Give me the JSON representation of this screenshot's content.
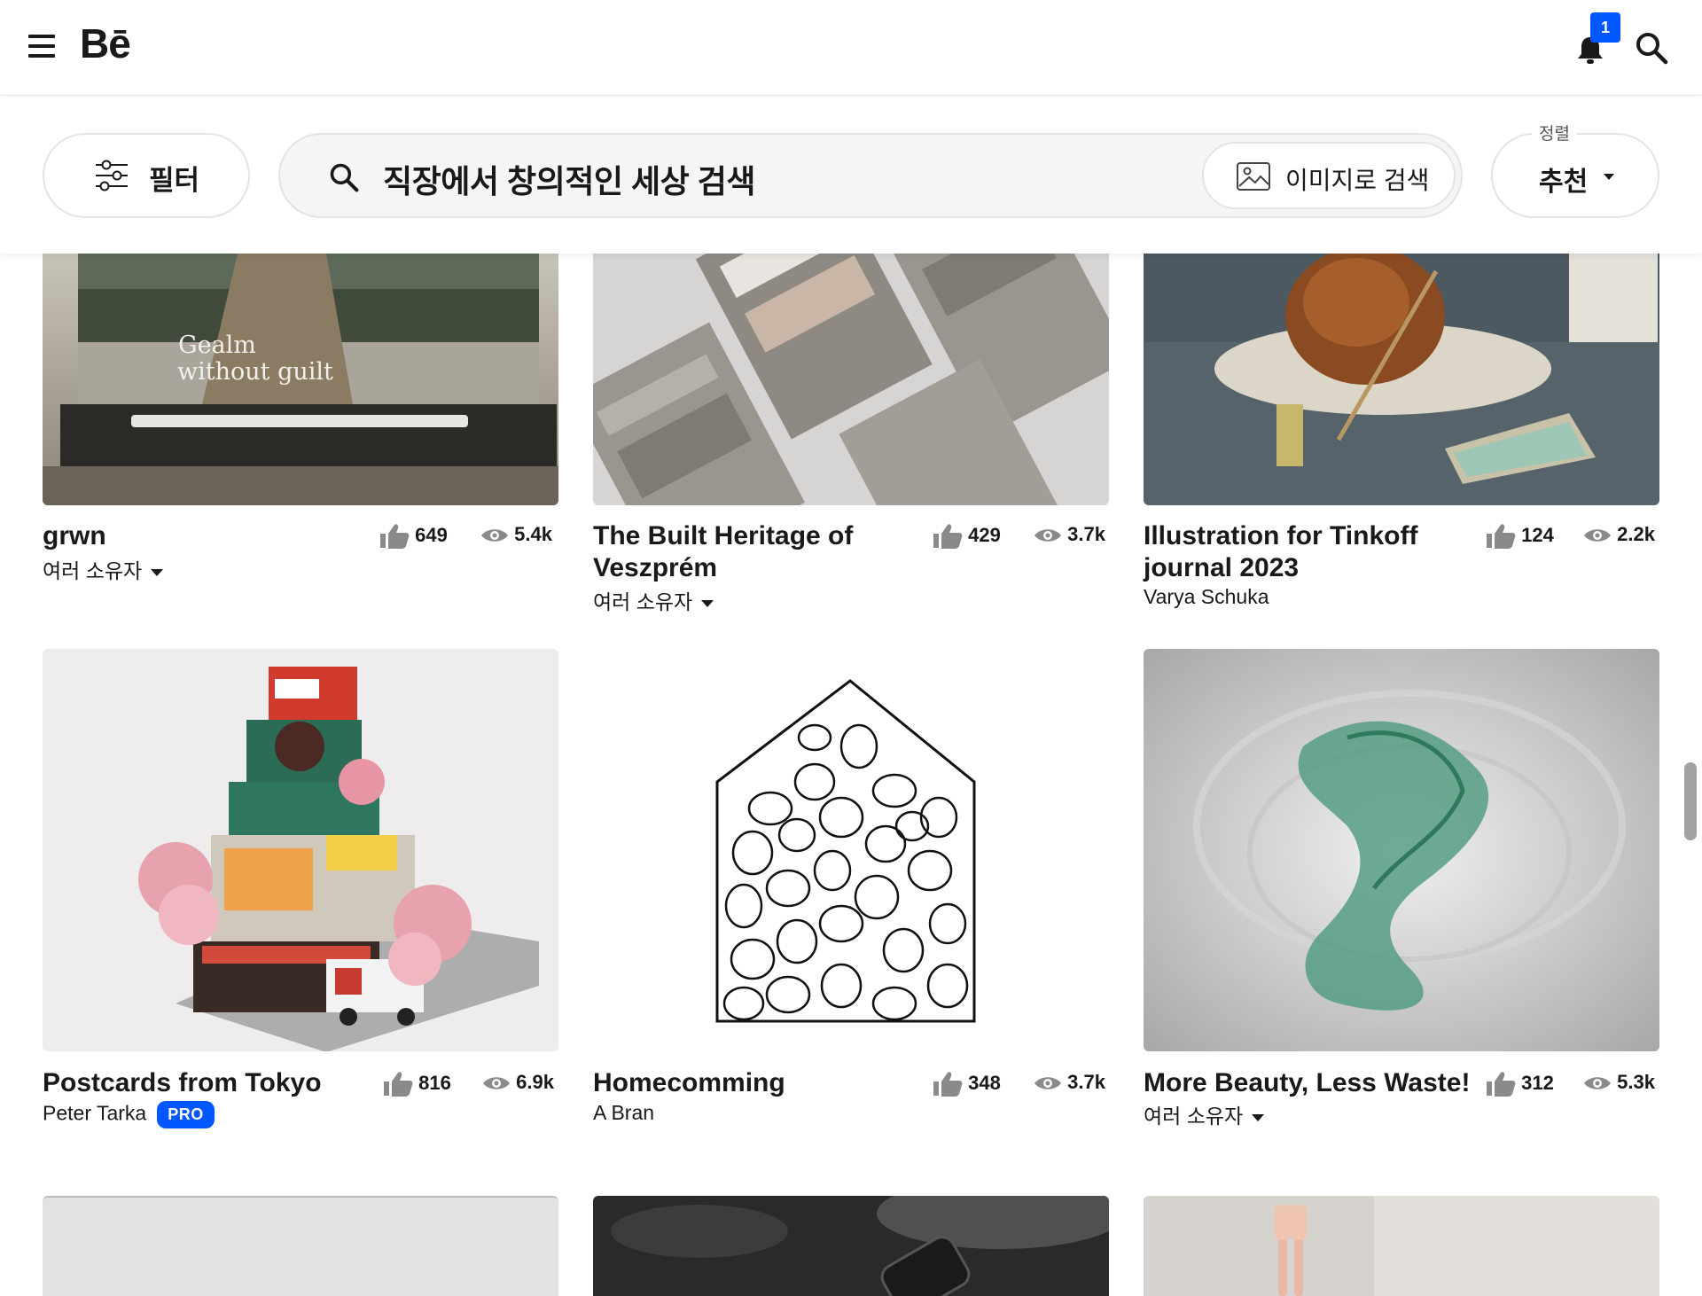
{
  "header": {
    "logo": "Bē",
    "notification_count": "1"
  },
  "filters": {
    "filter_label": "필터",
    "search_placeholder": "직장에서 창의적인 세상 검색",
    "image_search_label": "이미지로 검색",
    "sort_caption": "정렬",
    "sort_value": "추천"
  },
  "projects": [
    {
      "title": "grwn",
      "owner": "여러 소유자",
      "owner_dropdown": true,
      "likes": "649",
      "views": "5.4k",
      "image_text_1": "Gealm",
      "image_text_2": "without guilt"
    },
    {
      "title": "The Built Heritage of Veszprém",
      "owner": "여러 소유자",
      "owner_dropdown": true,
      "likes": "429",
      "views": "3.7k"
    },
    {
      "title": "Illustration for Tinkoff journal 2023",
      "owner": "Varya Schuka",
      "owner_dropdown": false,
      "likes": "124",
      "views": "2.2k"
    },
    {
      "title": "Postcards from Tokyo",
      "owner": "Peter Tarka",
      "owner_dropdown": false,
      "pro": "PRO",
      "likes": "816",
      "views": "6.9k"
    },
    {
      "title": "Homecomming",
      "owner": "A Bran",
      "owner_dropdown": false,
      "likes": "348",
      "views": "3.7k"
    },
    {
      "title": "More Beauty, Less Waste!",
      "owner": "여러 소유자",
      "owner_dropdown": true,
      "likes": "312",
      "views": "5.3k"
    }
  ],
  "colors": {
    "accent": "#0057ff",
    "text": "#191919"
  }
}
